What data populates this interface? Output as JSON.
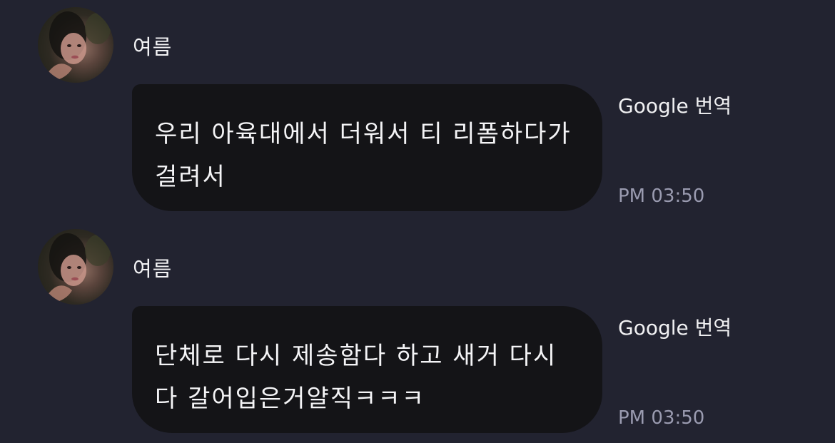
{
  "messages": [
    {
      "sender": "여름",
      "text": "우리 아육대에서 더워서 티 리폼하다가 걸려서",
      "translate_label": "Google 번역",
      "time": "PM 03:50"
    },
    {
      "sender": "여름",
      "text": "단체로 다시 제송함다 하고 새거 다시 다 갈어입은거얄직ㅋㅋㅋ",
      "translate_label": "Google 번역",
      "time": "PM 03:50"
    }
  ],
  "colors": {
    "background": "#222330",
    "bubble": "#141417",
    "text": "#f4f4f6",
    "timestamp": "#9a9bb0"
  }
}
